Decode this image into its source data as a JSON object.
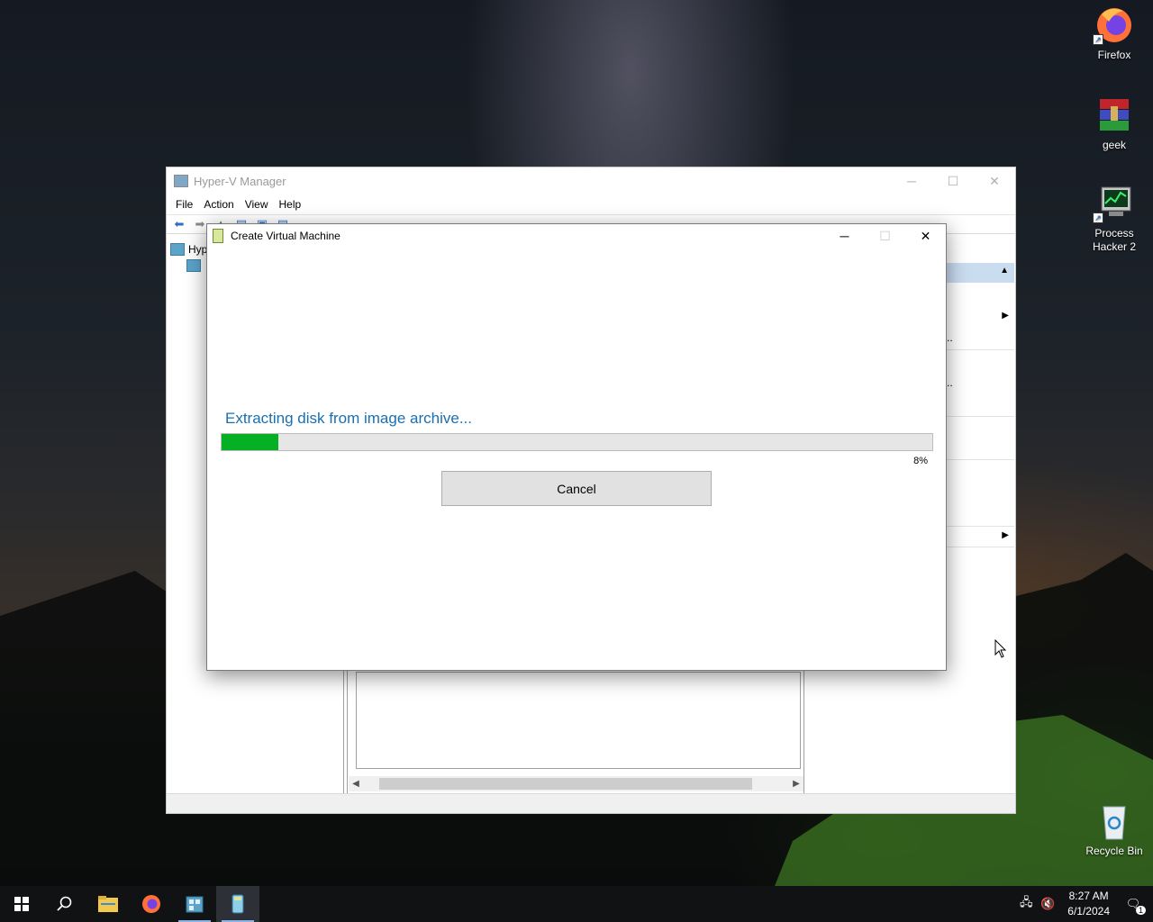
{
  "desktop": {
    "icons": [
      {
        "label": "Firefox",
        "icon": "firefox-icon"
      },
      {
        "label": "geek",
        "icon": "winrar-archive-icon"
      },
      {
        "label": "Process Hacker 2",
        "icon": "process-hacker-icon"
      },
      {
        "label": "Recycle Bin",
        "icon": "recycle-bin-icon"
      }
    ]
  },
  "hyperv": {
    "title": "Hyper-V Manager",
    "menu": [
      "File",
      "Action",
      "View",
      "Help"
    ],
    "tree_root_label": "Hyp",
    "action_dots_1": "..",
    "action_dots_2": ".."
  },
  "dialog": {
    "title": "Create Virtual Machine",
    "status": "Extracting disk from image archive...",
    "progress_percent": 8,
    "progress_label": "8%",
    "cancel_label": "Cancel"
  },
  "taskbar": {
    "time": "8:27 AM",
    "date": "6/1/2024",
    "notification_count": "1",
    "colors": {
      "accent": "#8ab4e8",
      "progress_fill": "#06b025",
      "status_text": "#1a6fb0"
    }
  }
}
